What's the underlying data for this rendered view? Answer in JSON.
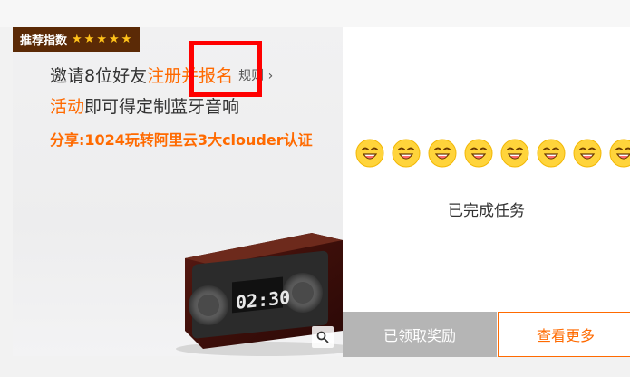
{
  "badge": {
    "label": "推荐指数",
    "stars": 5,
    "star_color": "#ffc21a"
  },
  "headline": {
    "part1": "邀请8位好友",
    "part2": "注册并报名",
    "rules": "规则",
    "rules_arrow": "›",
    "part3": "活动",
    "part4": "即可得定制蓝牙音响"
  },
  "share_text": "分享:1024玩转阿里云3大clouder认证",
  "product_icon": "bluetooth-speaker-clock",
  "speaker_display": "02:30",
  "zoom_icon": "magnifier-icon",
  "emoji_count": 8,
  "task_status": "已完成任务",
  "buttons": {
    "claimed": "已领取奖励",
    "more": "查看更多"
  },
  "colors": {
    "accent": "#ff6a00",
    "badge_bg": "#5b2a06",
    "disabled": "#b5b5b5",
    "highlight": "#ff0000"
  }
}
